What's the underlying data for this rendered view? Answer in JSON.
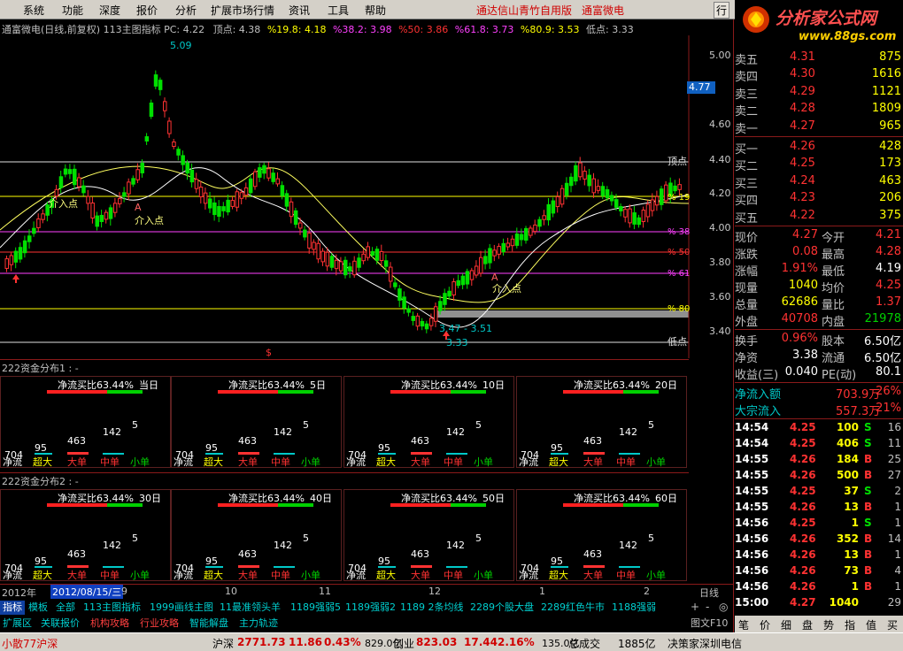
{
  "menu": {
    "items": [
      "系统",
      "功能",
      "深度",
      "报价",
      "分析",
      "扩展市场行情",
      "资讯",
      "工具",
      "帮助"
    ],
    "center_title": "通达信山青竹自用版",
    "stock_title": "通富微电",
    "right_button": "行"
  },
  "logo": {
    "title": "分析家公式网",
    "url": "www.88gs.com"
  },
  "chart_header": {
    "name": "通富微电(日线,前复权)",
    "indicator": "113主图指标",
    "pc": "PC: 4.22",
    "top": "顶点: 4.38",
    "p19": "%19.8: 4.18",
    "p38": "%38.2: 3.98",
    "p50": "%50: 3.86",
    "p61": "%61.8: 3.73",
    "p80": "%80.9: 3.53",
    "low": "低点: 3.33"
  },
  "price_axis": [
    "5.00",
    "4.60",
    "4.40",
    "4.20",
    "4.00",
    "3.80",
    "3.60",
    "3.40"
  ],
  "current_price_tag": "4.77",
  "chart_labels": {
    "high_mark": "5.09",
    "low_mark": "3.33",
    "range_mark": "3.47 - 3.51",
    "entry": "介入点",
    "a_mark": "A",
    "top_line": "顶点",
    "low_line": "低点",
    "fib_19": "% 19",
    "fib_38": "% 38",
    "fib_50": "% 50",
    "fib_61": "% 61",
    "fib_80": "% 80",
    "s_mark": "$"
  },
  "money_flow_1": {
    "header": "222资金分布1 : -",
    "panels": [
      "当日",
      "5日",
      "10日",
      "20日"
    ]
  },
  "money_flow_2": {
    "header": "222资金分布2 : -",
    "panels": [
      "30日",
      "40日",
      "50日",
      "60日"
    ]
  },
  "flow_panel": {
    "title": "净流买比63.44%",
    "v704": "704",
    "v95": "95",
    "v463": "463",
    "v142": "142",
    "v5": "5",
    "labels": [
      "净流",
      "超大",
      "大单",
      "中单",
      "小单"
    ]
  },
  "time_axis": {
    "year": "2012年",
    "date": "2012/08/15/三",
    "months": [
      "9",
      "10",
      "11",
      "12",
      "1",
      "2"
    ],
    "period": "日线",
    "buttons": [
      "+",
      "-",
      "◎"
    ],
    "f10": "图文F10"
  },
  "bottom_tabs": [
    "指标",
    "模板",
    "全部",
    "113主图指标",
    "1999画线主图",
    "11最准领头羊",
    "1189强弱5",
    "1189强弱2",
    "1189 2条均线",
    "2289个股大盘",
    "2289红色牛市",
    "1188强弱"
  ],
  "bottom_tabs2": [
    "扩展区",
    "关联报价",
    "机构攻略",
    "行业攻略",
    "智能解盘",
    "主力轨迹"
  ],
  "quotes": {
    "asks": [
      {
        "label": "卖五",
        "price": "4.31",
        "vol": "875"
      },
      {
        "label": "卖四",
        "price": "4.30",
        "vol": "1616"
      },
      {
        "label": "卖三",
        "price": "4.29",
        "vol": "1121"
      },
      {
        "label": "卖二",
        "price": "4.28",
        "vol": "1809"
      },
      {
        "label": "卖一",
        "price": "4.27",
        "vol": "965"
      }
    ],
    "bids": [
      {
        "label": "买一",
        "price": "4.26",
        "vol": "428"
      },
      {
        "label": "买二",
        "price": "4.25",
        "vol": "173"
      },
      {
        "label": "买三",
        "price": "4.24",
        "vol": "463"
      },
      {
        "label": "买四",
        "price": "4.23",
        "vol": "206"
      },
      {
        "label": "买五",
        "price": "4.22",
        "vol": "375"
      }
    ],
    "stats": [
      {
        "l1": "现价",
        "v1": "4.27",
        "l2": "今开",
        "v2": "4.21"
      },
      {
        "l1": "涨跌",
        "v1": "0.08",
        "l2": "最高",
        "v2": "4.28"
      },
      {
        "l1": "涨幅",
        "v1": "1.91%",
        "l2": "最低",
        "v2": "4.19"
      },
      {
        "l1": "现量",
        "v1": "1040",
        "l2": "均价",
        "v2": "4.25"
      },
      {
        "l1": "总量",
        "v1": "62686",
        "l2": "量比",
        "v2": "1.37"
      },
      {
        "l1": "外盘",
        "v1": "40708",
        "l2": "内盘",
        "v2": "21978"
      }
    ],
    "stats2": [
      {
        "l1": "换手",
        "v1": "0.96%",
        "l2": "股本",
        "v2": "6.50亿"
      },
      {
        "l1": "净资",
        "v1": "3.38",
        "l2": "流通",
        "v2": "6.50亿"
      },
      {
        "l1": "收益(三)",
        "v1": "0.040",
        "l2": "PE(动)",
        "v2": "80.1"
      }
    ],
    "flows": [
      {
        "label": "净流入额",
        "value": "703.9万",
        "pct": "26%"
      },
      {
        "label": "大宗流入",
        "value": "557.3万",
        "pct": "21%"
      }
    ]
  },
  "ticks": [
    {
      "t": "14:54",
      "p": "4.25",
      "v": "100",
      "f": "S",
      "n": "16"
    },
    {
      "t": "14:54",
      "p": "4.25",
      "v": "406",
      "f": "S",
      "n": "11"
    },
    {
      "t": "14:55",
      "p": "4.26",
      "v": "184",
      "f": "B",
      "n": "25"
    },
    {
      "t": "14:55",
      "p": "4.26",
      "v": "500",
      "f": "B",
      "n": "27"
    },
    {
      "t": "14:55",
      "p": "4.25",
      "v": "37",
      "f": "S",
      "n": "2"
    },
    {
      "t": "14:55",
      "p": "4.26",
      "v": "13",
      "f": "B",
      "n": "1"
    },
    {
      "t": "14:56",
      "p": "4.25",
      "v": "1",
      "f": "S",
      "n": "1"
    },
    {
      "t": "14:56",
      "p": "4.26",
      "v": "352",
      "f": "B",
      "n": "14"
    },
    {
      "t": "14:56",
      "p": "4.26",
      "v": "13",
      "f": "B",
      "n": "1"
    },
    {
      "t": "14:56",
      "p": "4.26",
      "v": "73",
      "f": "B",
      "n": "4"
    },
    {
      "t": "14:56",
      "p": "4.26",
      "v": "1",
      "f": "B",
      "n": "1"
    },
    {
      "t": "15:00",
      "p": "4.27",
      "v": "1040",
      "f": "",
      "n": "29"
    }
  ],
  "right_tabs": [
    "笔",
    "价",
    "细",
    "盘",
    "势",
    "指",
    "值",
    "买"
  ],
  "status": {
    "left": "小散77沪深",
    "sh_label": "沪深",
    "sh_price": "2771.73",
    "sh_chg": "11.86",
    "sh_pct": "0.43%",
    "sh_amt": "829.0亿",
    "sz_label": "创业",
    "sz_price": "823.03",
    "sz_chg": "17.44",
    "sz_pct": "2.16%",
    "sz_amt": "135.0亿",
    "total_label": "总成交",
    "total": "1885亿",
    "right": "决策家深圳电信"
  },
  "colors": {
    "up": "#ff3232",
    "down": "#00e000",
    "cyan": "#00c8c8",
    "yellow": "#ffff00",
    "magenta": "#ff40ff"
  }
}
